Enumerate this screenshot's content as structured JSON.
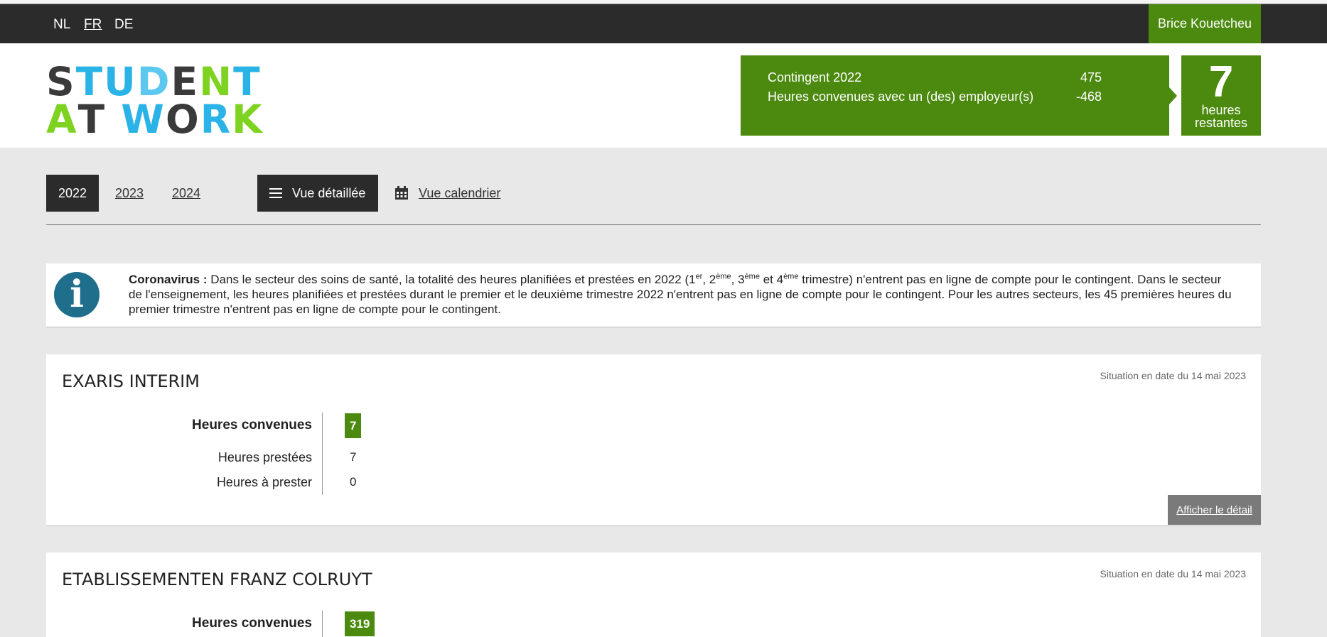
{
  "languages": [
    {
      "code": "NL",
      "active": false
    },
    {
      "code": "FR",
      "active": true
    },
    {
      "code": "DE",
      "active": false
    }
  ],
  "user": {
    "name": "Brice Kouetcheu"
  },
  "logo": {
    "line1": [
      {
        "ch": "S",
        "color": "#3a3a3a"
      },
      {
        "ch": "T",
        "color": "#2ab3e6"
      },
      {
        "ch": "U",
        "color": "#2ab3e6"
      },
      {
        "ch": "D",
        "color": "#5cc8f0"
      },
      {
        "ch": "E",
        "color": "#3a3a3a"
      },
      {
        "ch": "N",
        "color": "#7ed321"
      },
      {
        "ch": "T",
        "color": "#2ab3e6"
      }
    ],
    "line2": [
      {
        "ch": "A",
        "color": "#7ed321"
      },
      {
        "ch": "T",
        "color": "#3a3a3a"
      },
      {
        "ch": " ",
        "color": "#3a3a3a"
      },
      {
        "ch": "W",
        "color": "#2ab3e6"
      },
      {
        "ch": "O",
        "color": "#3a3a3a"
      },
      {
        "ch": "R",
        "color": "#2ab3e6"
      },
      {
        "ch": "K",
        "color": "#7ed321"
      }
    ]
  },
  "contingent": {
    "label": "Contingent 2022",
    "value": "475",
    "agreed_label": "Heures convenues avec un (des) employeur(s)",
    "agreed_value": "-468",
    "remaining_number": "7",
    "remaining_line1": "heures",
    "remaining_line2": "restantes"
  },
  "years": [
    {
      "label": "2022",
      "active": true
    },
    {
      "label": "2023",
      "active": false
    },
    {
      "label": "2024",
      "active": false
    }
  ],
  "views": {
    "detailed": "Vue détaillée",
    "calendar": "Vue calendrier"
  },
  "notice": {
    "bold": "Coronavirus :",
    "part1": " Dans le secteur des soins de santé, la totalité des heures planifiées et prestées en 2022 (1",
    "sup1": "er",
    "part2": ", 2",
    "sup2": "ème",
    "part3": ", 3",
    "sup3": "ème",
    "part4": " et 4",
    "sup4": "ème",
    "part5": " trimestre) n'entrent pas en ligne de compte pour le contingent. Dans le secteur de l'enseignement, les heures planifiées et prestées durant le premier et le deuxième trimestre 2022 n'entrent pas en ligne de compte pour le contingent. Pour les autres secteurs, les 45 premières heures du premier trimestre n'entrent pas en ligne de compte pour le contingent."
  },
  "employers": [
    {
      "name": "EXARIS INTERIM",
      "date": "Situation en date du 14 mai 2023",
      "agreed_label": "Heures convenues",
      "agreed_value": "7",
      "performed_label": "Heures prestées",
      "performed_value": "7",
      "todo_label": "Heures à prester",
      "todo_value": "0",
      "detail_button": "Afficher le détail"
    },
    {
      "name": "ETABLISSEMENTEN FRANZ COLRUYT",
      "date": "Situation en date du 14 mai 2023",
      "agreed_label": "Heures convenues",
      "agreed_value": "319"
    }
  ],
  "colors": {
    "brand_green": "#4b8a0e",
    "dark_bar": "#2b2b2b",
    "info_blue": "#1e6e8c"
  }
}
